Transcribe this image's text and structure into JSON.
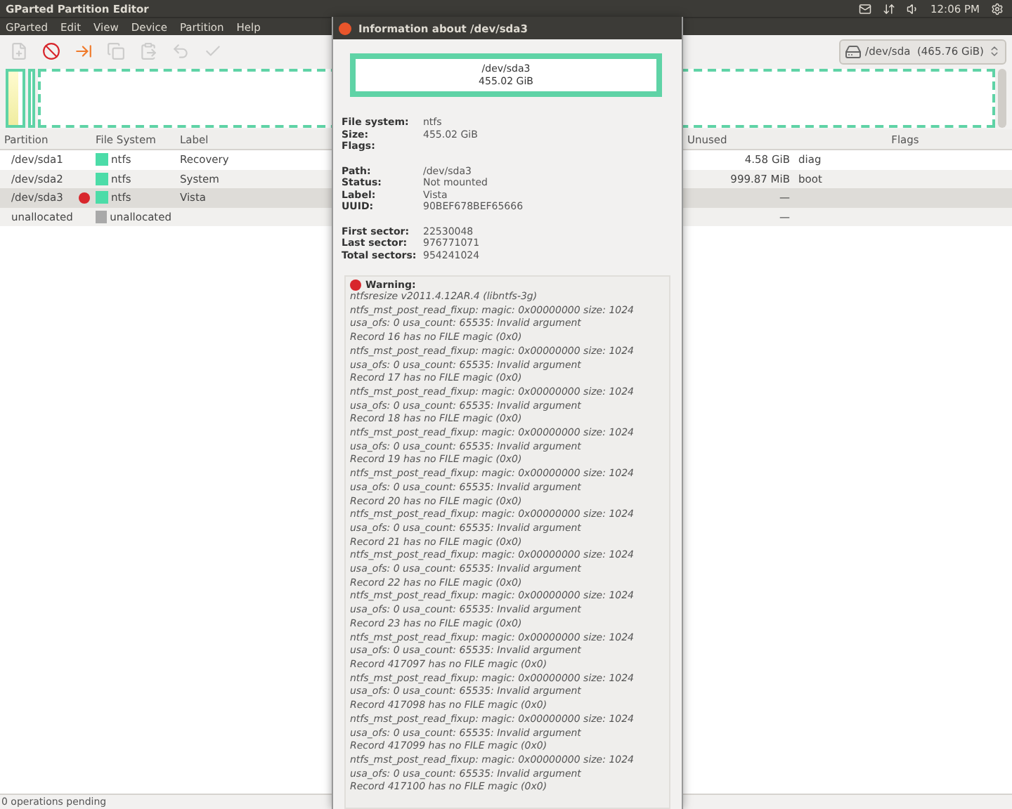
{
  "panel": {
    "title": "GParted Partition Editor",
    "clock": "12:06 PM"
  },
  "menu": [
    "GParted",
    "Edit",
    "View",
    "Device",
    "Partition",
    "Help"
  ],
  "toolbar": [
    {
      "kind": "new",
      "disabled": true
    },
    {
      "kind": "delete",
      "disabled": false
    },
    {
      "kind": "resize",
      "disabled": false
    },
    {
      "kind": "copy",
      "disabled": true
    },
    {
      "kind": "paste",
      "disabled": true
    },
    {
      "kind": "undo",
      "disabled": true
    },
    {
      "kind": "apply",
      "disabled": true
    }
  ],
  "device": {
    "path": "/dev/sda",
    "size": "(465.76 GiB)"
  },
  "graph": [
    {
      "selected": false
    },
    {
      "selected": false
    },
    {
      "selected": true
    }
  ],
  "table": {
    "columns": [
      "Partition",
      "File System",
      "Label",
      "Unused",
      "Flags"
    ],
    "rows": [
      {
        "partition": "/dev/sda1",
        "warning": false,
        "fs": "ntfs",
        "color": "#4cdca8",
        "label": "Recovery",
        "unused": "4.58 GiB",
        "flags": "diag",
        "selected": false
      },
      {
        "partition": "/dev/sda2",
        "warning": false,
        "fs": "ntfs",
        "color": "#4cdca8",
        "label": "System",
        "unused": "999.87 MiB",
        "flags": "boot",
        "selected": false
      },
      {
        "partition": "/dev/sda3",
        "warning": true,
        "fs": "ntfs",
        "color": "#4cdca8",
        "label": "Vista",
        "unused": "—",
        "flags": "",
        "selected": true
      },
      {
        "partition": "unallocated",
        "warning": false,
        "fs": "unallocated",
        "color": "#a9a9a9",
        "label": "",
        "unused": "—",
        "flags": "",
        "selected": false
      }
    ]
  },
  "status_bar": "0 operations pending",
  "dialog": {
    "title": "Information about /dev/sda3",
    "header": [
      "/dev/sda3",
      "455.02 GiB"
    ],
    "groups": [
      [
        {
          "label": "File system:",
          "value": "ntfs"
        },
        {
          "label": "Size:",
          "value": "455.02 GiB"
        },
        {
          "label": "Flags:"
        }
      ],
      [
        {
          "label": "Path:",
          "value": "/dev/sda3"
        },
        {
          "label": "Status:",
          "value": "Not mounted"
        },
        {
          "label": "Label:",
          "value": "Vista"
        },
        {
          "label": "UUID:",
          "value": "90BEF678BEF65666"
        }
      ],
      [
        {
          "label": "First sector:",
          "value": "22530048"
        },
        {
          "label": "Last sector:",
          "value": "976771071"
        },
        {
          "label": "Total sectors:",
          "value": "954241024"
        }
      ]
    ],
    "warning": {
      "title": "Warning:",
      "lines": [
        "ntfsresize v2011.4.12AR.4 (libntfs-3g)",
        "ntfs_mst_post_read_fixup: magic: 0x00000000  size: 1024",
        "usa_ofs: 0  usa_count: 65535: Invalid argument",
        "Record 16 has no FILE magic (0x0)",
        "ntfs_mst_post_read_fixup: magic: 0x00000000  size: 1024",
        "usa_ofs: 0  usa_count: 65535: Invalid argument",
        "Record 17 has no FILE magic (0x0)",
        "ntfs_mst_post_read_fixup: magic: 0x00000000  size: 1024",
        "usa_ofs: 0  usa_count: 65535: Invalid argument",
        "Record 18 has no FILE magic (0x0)",
        "ntfs_mst_post_read_fixup: magic: 0x00000000  size: 1024",
        "usa_ofs: 0  usa_count: 65535: Invalid argument",
        "Record 19 has no FILE magic (0x0)",
        "ntfs_mst_post_read_fixup: magic: 0x00000000  size: 1024",
        "usa_ofs: 0  usa_count: 65535: Invalid argument",
        "Record 20 has no FILE magic (0x0)",
        "ntfs_mst_post_read_fixup: magic: 0x00000000  size: 1024",
        "usa_ofs: 0  usa_count: 65535: Invalid argument",
        "Record 21 has no FILE magic (0x0)",
        "ntfs_mst_post_read_fixup: magic: 0x00000000  size: 1024",
        "usa_ofs: 0  usa_count: 65535: Invalid argument",
        "Record 22 has no FILE magic (0x0)",
        "ntfs_mst_post_read_fixup: magic: 0x00000000  size: 1024",
        "usa_ofs: 0  usa_count: 65535: Invalid argument",
        "Record 23 has no FILE magic (0x0)",
        "ntfs_mst_post_read_fixup: magic: 0x00000000  size: 1024",
        "usa_ofs: 0  usa_count: 65535: Invalid argument",
        "Record 417097 has no FILE magic (0x0)",
        "ntfs_mst_post_read_fixup: magic: 0x00000000  size: 1024",
        "usa_ofs: 0  usa_count: 65535: Invalid argument",
        "Record 417098 has no FILE magic (0x0)",
        "ntfs_mst_post_read_fixup: magic: 0x00000000  size: 1024",
        "usa_ofs: 0  usa_count: 65535: Invalid argument",
        "Record 417099 has no FILE magic (0x0)",
        "ntfs_mst_post_read_fixup: magic: 0x00000000  size: 1024",
        "usa_ofs: 0  usa_count: 65535: Invalid argument",
        "Record 417100 has no FILE magic (0x0)"
      ]
    }
  }
}
